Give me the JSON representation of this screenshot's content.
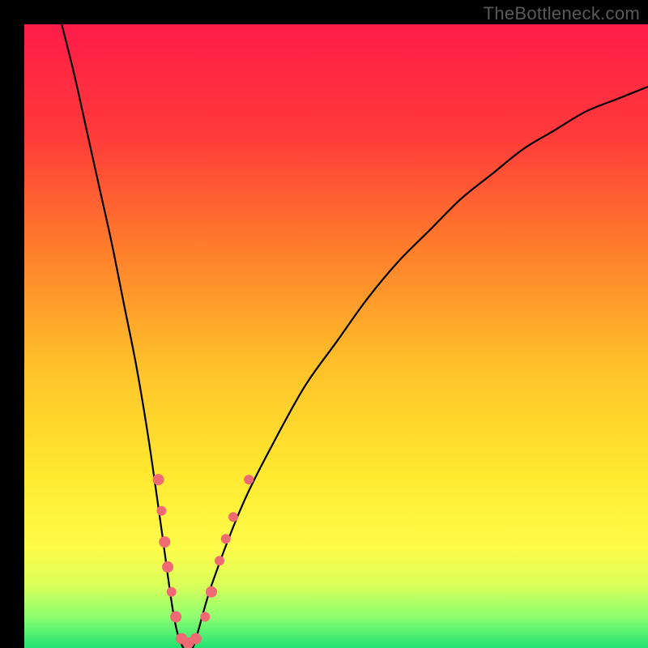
{
  "watermark": "TheBottleneck.com",
  "chart_data": {
    "type": "line",
    "title": "",
    "xlabel": "",
    "ylabel": "",
    "xlim": [
      0,
      100
    ],
    "ylim": [
      0,
      100
    ],
    "grid": false,
    "series": [
      {
        "name": "bottleneck-curve",
        "x": [
          6,
          8,
          10,
          12,
          14,
          16,
          18,
          20,
          22,
          24,
          25.5,
          27,
          30,
          35,
          40,
          45,
          50,
          55,
          60,
          65,
          70,
          75,
          80,
          85,
          90,
          95,
          100
        ],
        "y": [
          100,
          92,
          83,
          74,
          65,
          55,
          45,
          33,
          19,
          5,
          0,
          0,
          10,
          23,
          33,
          42,
          49,
          56,
          62,
          67,
          72,
          76,
          80,
          83,
          86,
          88,
          90
        ]
      }
    ],
    "markers": [
      {
        "x": 21.5,
        "y": 27,
        "r": 7
      },
      {
        "x": 22.0,
        "y": 22,
        "r": 6
      },
      {
        "x": 22.5,
        "y": 17,
        "r": 7
      },
      {
        "x": 23.0,
        "y": 13,
        "r": 7
      },
      {
        "x": 23.6,
        "y": 9,
        "r": 6
      },
      {
        "x": 24.3,
        "y": 5,
        "r": 7
      },
      {
        "x": 25.2,
        "y": 1.5,
        "r": 7
      },
      {
        "x": 26.3,
        "y": 0.8,
        "r": 7
      },
      {
        "x": 27.5,
        "y": 1.5,
        "r": 7
      },
      {
        "x": 29.0,
        "y": 5,
        "r": 6
      },
      {
        "x": 30.0,
        "y": 9,
        "r": 7
      },
      {
        "x": 31.3,
        "y": 14,
        "r": 6
      },
      {
        "x": 32.3,
        "y": 17.5,
        "r": 6
      },
      {
        "x": 33.5,
        "y": 21,
        "r": 6
      },
      {
        "x": 36.0,
        "y": 27,
        "r": 6
      }
    ],
    "background_gradient": {
      "stops": [
        {
          "offset": 0,
          "color": "#ff1c49"
        },
        {
          "offset": 0.18,
          "color": "#ff3b3a"
        },
        {
          "offset": 0.35,
          "color": "#ff7a2c"
        },
        {
          "offset": 0.55,
          "color": "#ffc22a"
        },
        {
          "offset": 0.72,
          "color": "#ffe92f"
        },
        {
          "offset": 0.84,
          "color": "#fffc4a"
        },
        {
          "offset": 0.9,
          "color": "#d9ff5a"
        },
        {
          "offset": 0.95,
          "color": "#8dff70"
        },
        {
          "offset": 1.0,
          "color": "#22e274"
        }
      ]
    },
    "marker_color": "#ef6a73",
    "curve_color": "#000000"
  }
}
